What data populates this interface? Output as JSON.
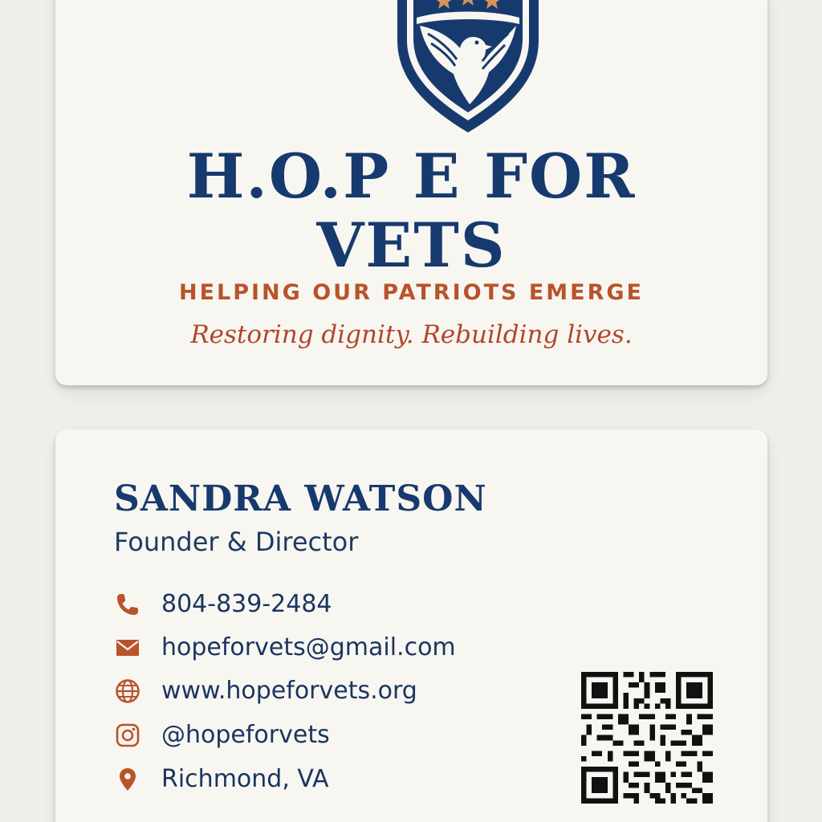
{
  "front": {
    "org_name_line1": "H.O.P E FOR",
    "org_name_line2": "VETS",
    "tagline": "HELPING OUR PATRIOTS EMERGE",
    "motto": "Restoring dignity. Rebuilding lives.",
    "logo_icon": "eagle-shield-icon"
  },
  "back": {
    "name": "SANDRA WATSON",
    "title": "Founder & Director",
    "contacts": [
      {
        "icon": "phone-icon",
        "text": "804-839-2484"
      },
      {
        "icon": "email-icon",
        "text": "hopeforvets@gmail.com"
      },
      {
        "icon": "globe-icon",
        "text": "www.hopeforvets.org"
      },
      {
        "icon": "instagram-icon",
        "text": "@hopeforvets"
      },
      {
        "icon": "location-pin-icon",
        "text": "Richmond, VA"
      }
    ],
    "qr_icon": "qr-code-icon"
  },
  "colors": {
    "navy": "#173a6e",
    "accent": "#b8532a",
    "star": "#d4935a",
    "card": "#f8f6f1",
    "background": "#f1efea"
  }
}
